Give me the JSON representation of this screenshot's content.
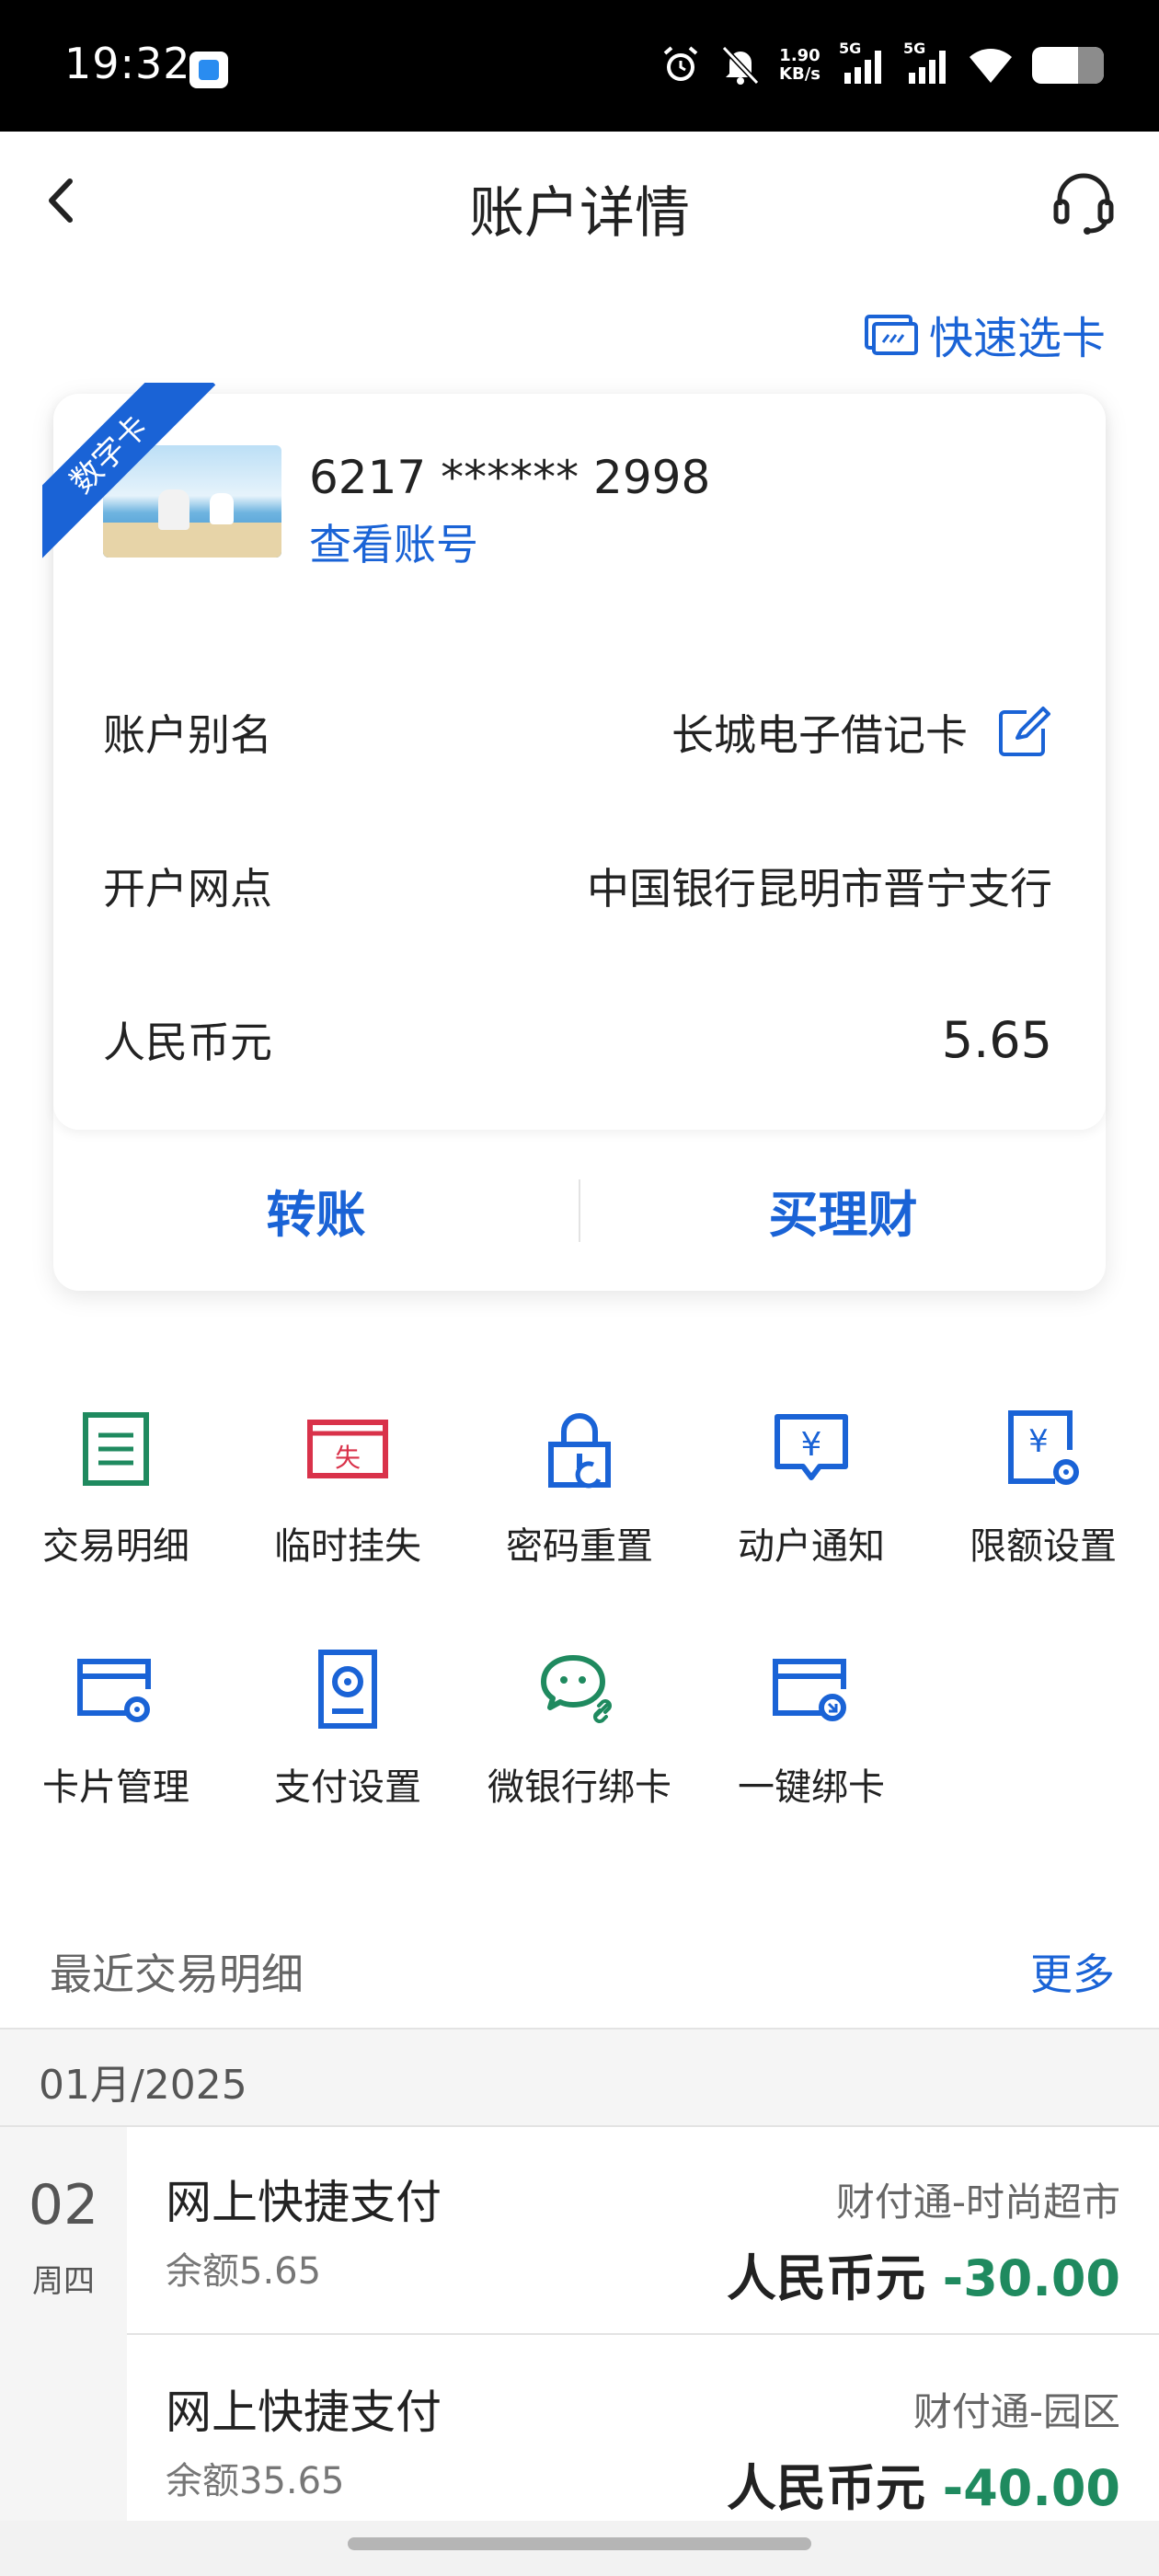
{
  "status_bar": {
    "time": "19:32",
    "net_speed_value": "1.90",
    "net_speed_unit": "KB/s",
    "signal1_label": "5G",
    "signal2_label": "5G",
    "icons": [
      "alarm-icon",
      "mute-bell-icon",
      "signal-icon",
      "wifi-icon",
      "battery-icon"
    ]
  },
  "header": {
    "title": "账户详情",
    "back_icon": "chevron-left-icon",
    "service_icon": "headset-icon"
  },
  "quick_select": {
    "label": "快速选卡",
    "icon": "card-switch-icon"
  },
  "card": {
    "ribbon": "数字卡",
    "number": "6217 ****** 2998",
    "view_account": "查看账号",
    "rows": [
      {
        "label": "账户别名",
        "value": "长城电子借记卡"
      },
      {
        "label": "开户网点",
        "value": "中国银行昆明市晋宁支行"
      },
      {
        "label": "人民币元",
        "value": "5.65"
      }
    ],
    "actions": {
      "transfer": "转账",
      "buy_wealth": "买理财"
    }
  },
  "functions": [
    {
      "label": "交易明细",
      "icon": "document-list-icon",
      "color": "#1f8a5f"
    },
    {
      "label": "临时挂失",
      "icon": "report-loss-icon",
      "color": "#d9324a"
    },
    {
      "label": "密码重置",
      "icon": "lock-reset-icon",
      "color": "#1a63d6"
    },
    {
      "label": "动户通知",
      "icon": "yuan-message-icon",
      "color": "#1a63d6"
    },
    {
      "label": "限额设置",
      "icon": "yuan-gear-icon",
      "color": "#1a63d6"
    },
    {
      "label": "卡片管理",
      "icon": "card-gear-icon",
      "color": "#1a63d6"
    },
    {
      "label": "支付设置",
      "icon": "payment-settings-icon",
      "color": "#1a63d6"
    },
    {
      "label": "微银行绑卡",
      "icon": "wechat-link-icon",
      "color": "#1f8a5f"
    },
    {
      "label": "一键绑卡",
      "icon": "card-bind-icon",
      "color": "#1a63d6"
    }
  ],
  "recent": {
    "title": "最近交易明细",
    "more": "更多",
    "month": "01月/2025",
    "date": {
      "day": "02",
      "weekday": "周四"
    },
    "transactions": [
      {
        "title": "网上快捷支付",
        "balance": "余额5.65",
        "merchant": "财付通-时尚超市",
        "currency": "人民币元",
        "amount": "-30.00"
      },
      {
        "title": "网上快捷支付",
        "balance": "余额35.65",
        "merchant": "财付通-园区",
        "currency": "人民币元",
        "amount": "-40.00"
      }
    ]
  },
  "colors": {
    "accent": "#1a63d6",
    "negative_amount": "#1f8a5f",
    "loss_red": "#d9324a"
  }
}
